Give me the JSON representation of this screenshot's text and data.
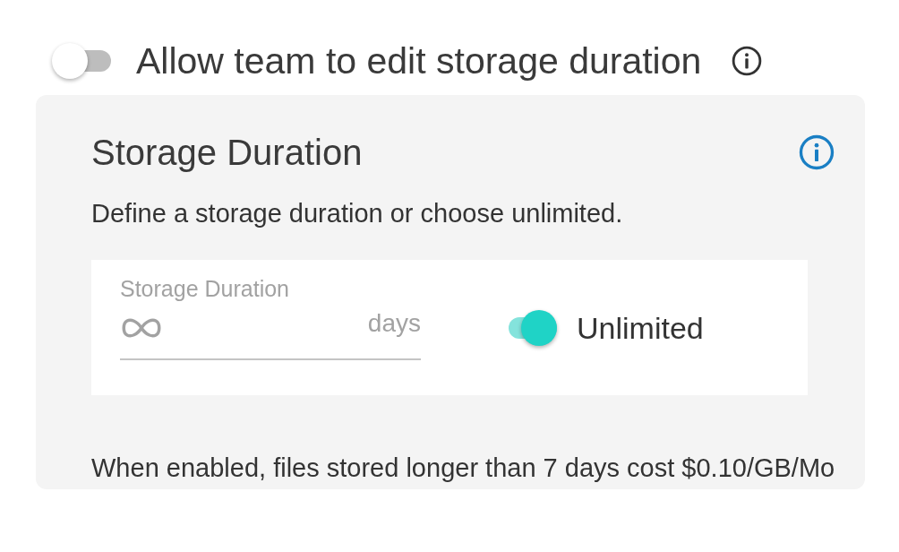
{
  "team_setting": {
    "label": "Allow team to edit storage duration",
    "on": false
  },
  "card": {
    "title": "Storage Duration",
    "description": "Define a storage duration or choose unlimited.",
    "duration_field": {
      "label": "Storage Duration",
      "suffix": "days",
      "disabled": true
    },
    "unlimited_toggle": {
      "label": "Unlimited",
      "on": true
    },
    "note": "When enabled, files stored longer than 7 days cost $0.10/GB/Mo"
  }
}
